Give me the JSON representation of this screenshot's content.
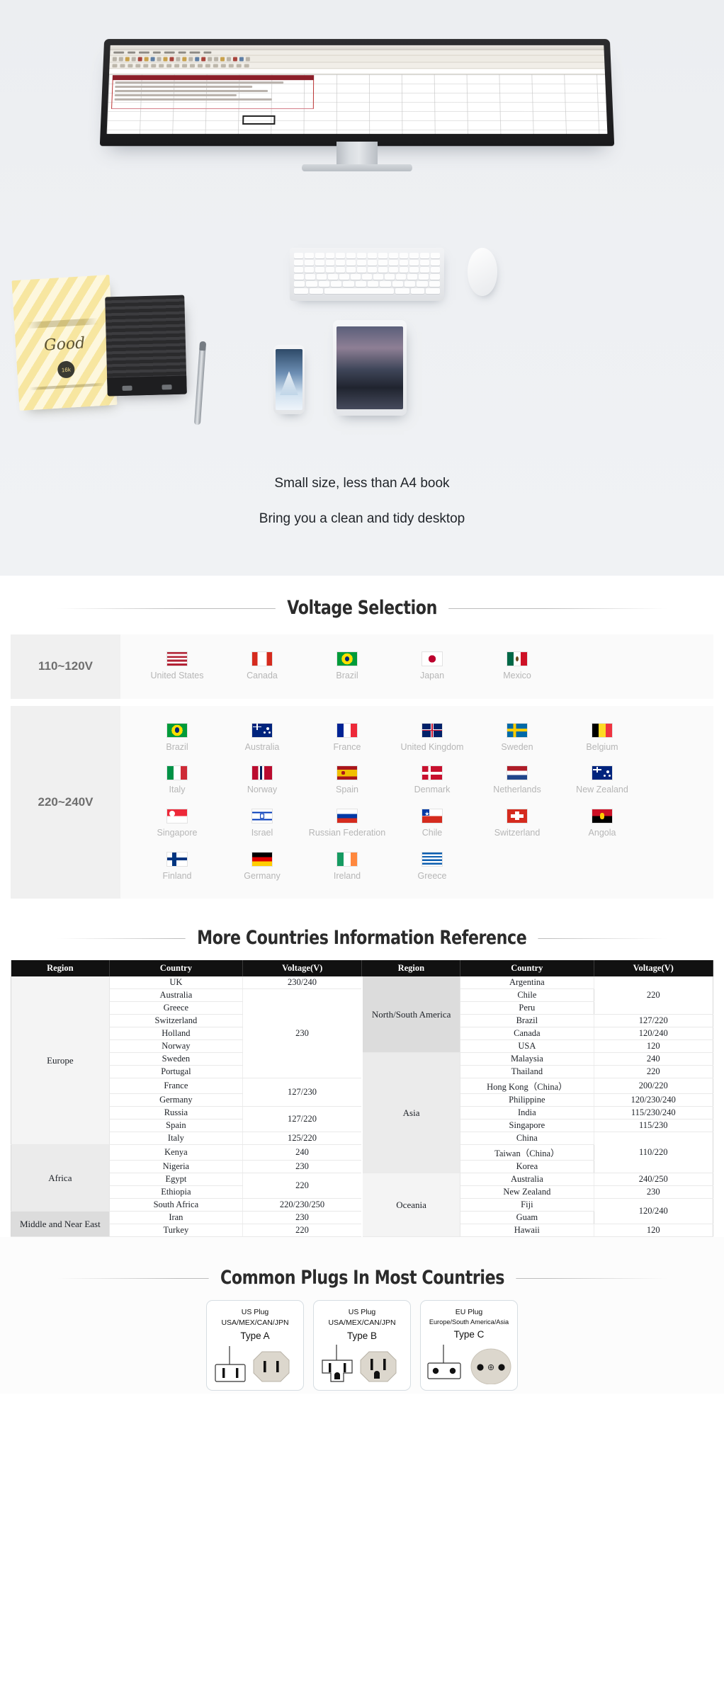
{
  "hero": {
    "caption_1": "Small size, less than A4 book",
    "caption_2": "Bring you a clean and tidy desktop",
    "notebook_label": "Good",
    "notebook_badge": "16k"
  },
  "voltage_section": {
    "title": "Voltage Selection",
    "groups": [
      {
        "label": "110~120V",
        "countries": [
          {
            "name": "United States",
            "flag": "us"
          },
          {
            "name": "Canada",
            "flag": "ca"
          },
          {
            "name": "Brazil",
            "flag": "br"
          },
          {
            "name": "Japan",
            "flag": "jp"
          },
          {
            "name": "Mexico",
            "flag": "mx"
          }
        ]
      },
      {
        "label": "220~240V",
        "countries": [
          {
            "name": "Brazil",
            "flag": "br"
          },
          {
            "name": "Australia",
            "flag": "au"
          },
          {
            "name": "France",
            "flag": "fr"
          },
          {
            "name": "United Kingdom",
            "flag": "gb"
          },
          {
            "name": "Sweden",
            "flag": "se"
          },
          {
            "name": "Belgium",
            "flag": "be"
          },
          {
            "name": "Italy",
            "flag": "it"
          },
          {
            "name": "Norway",
            "flag": "no"
          },
          {
            "name": "Spain",
            "flag": "es"
          },
          {
            "name": "Denmark",
            "flag": "dk"
          },
          {
            "name": "Netherlands",
            "flag": "nl"
          },
          {
            "name": "New Zealand",
            "flag": "nz"
          },
          {
            "name": "Singapore",
            "flag": "sg"
          },
          {
            "name": "Israel",
            "flag": "il"
          },
          {
            "name": "Russian Federation",
            "flag": "ru"
          },
          {
            "name": "Chile",
            "flag": "cl"
          },
          {
            "name": "Switzerland",
            "flag": "ch"
          },
          {
            "name": "Angola",
            "flag": "ao"
          },
          {
            "name": "Finland",
            "flag": "fi"
          },
          {
            "name": "Germany",
            "flag": "de"
          },
          {
            "name": "Ireland",
            "flag": "ie"
          },
          {
            "name": "Greece",
            "flag": "gr"
          }
        ]
      }
    ]
  },
  "reference_section": {
    "title": "More Countries Information Reference",
    "headers": [
      "Region",
      "Country",
      "Voltage(V)",
      "Region",
      "Country",
      "Voltage(V)"
    ],
    "left_rows": [
      {
        "region": "Europe",
        "region_span": 13,
        "region_shade": "light",
        "country": "UK",
        "voltage": "230/240",
        "voltage_span": 1
      },
      {
        "country": "Australia",
        "voltage": "230",
        "voltage_span": 7
      },
      {
        "country": "Greece"
      },
      {
        "country": "Switzerland"
      },
      {
        "country": "Holland"
      },
      {
        "country": "Norway"
      },
      {
        "country": "Sweden"
      },
      {
        "country": "Portugal"
      },
      {
        "country": "France",
        "voltage": "127/230",
        "voltage_span": 2
      },
      {
        "country": "Germany"
      },
      {
        "country": "Russia",
        "voltage": "127/220",
        "voltage_span": 2
      },
      {
        "country": "Spain"
      },
      {
        "country": "Italy",
        "voltage": "125/220",
        "voltage_span": 1
      },
      {
        "region": "Africa",
        "region_span": 5,
        "region_shade": "md",
        "country": "Kenya",
        "voltage": "240",
        "voltage_span": 1
      },
      {
        "country": "Nigeria",
        "voltage": "230",
        "voltage_span": 1
      },
      {
        "country": "Egypt",
        "voltage": "220",
        "voltage_span": 2
      },
      {
        "country": "Ethiopia"
      },
      {
        "country": "South Africa",
        "voltage": "220/230/250",
        "voltage_span": 1
      },
      {
        "region": "Middle and Near East",
        "region_span": 2,
        "region_shade": "dk",
        "country": "Iran",
        "voltage": "230",
        "voltage_span": 1
      },
      {
        "country": "Turkey",
        "voltage": "220",
        "voltage_span": 1
      }
    ],
    "right_rows": [
      {
        "region": "North/South America",
        "region_span": 6,
        "region_shade": "dk",
        "country": "Argentina",
        "voltage": "220",
        "voltage_span": 3
      },
      {
        "country": "Chile"
      },
      {
        "country": "Peru"
      },
      {
        "country": "Brazil",
        "voltage": "127/220",
        "voltage_span": 1
      },
      {
        "country": "Canada",
        "voltage": "120/240",
        "voltage_span": 1
      },
      {
        "country": "USA",
        "voltage": "120",
        "voltage_span": 1
      },
      {
        "region": "Asia",
        "region_span": 9,
        "region_shade": "md",
        "country": "Malaysia",
        "voltage": "240",
        "voltage_span": 1
      },
      {
        "country": "Thailand",
        "voltage": "220",
        "voltage_span": 1
      },
      {
        "country": "Hong Kong（China）",
        "voltage": "200/220",
        "voltage_span": 1
      },
      {
        "country": "Philippine",
        "voltage": "120/230/240",
        "voltage_span": 1
      },
      {
        "country": "India",
        "voltage": "115/230/240",
        "voltage_span": 1
      },
      {
        "country": "Singapore",
        "voltage": "115/230",
        "voltage_span": 1
      },
      {
        "country": "China",
        "voltage": "110/220",
        "voltage_span": 3
      },
      {
        "country": "Taiwan（China）"
      },
      {
        "country": "Korea"
      },
      {
        "region": "Oceania",
        "region_span": 5,
        "region_shade": "light",
        "country": "Australia",
        "voltage": "240/250",
        "voltage_span": 1
      },
      {
        "country": "New Zealand",
        "voltage": "230",
        "voltage_span": 1
      },
      {
        "country": "Fiji",
        "voltage": "120/240",
        "voltage_span": 2
      },
      {
        "country": "Guam"
      },
      {
        "country": "Hawaii",
        "voltage": "120",
        "voltage_span": 1
      }
    ]
  },
  "plugs_section": {
    "title": "Common Plugs In Most Countries",
    "cards": [
      {
        "line1": "US Plug",
        "line2": "USA/MEX/CAN/JPN",
        "line3": "Type A",
        "art": "type-a"
      },
      {
        "line1": "US Plug",
        "line2": "USA/MEX/CAN/JPN",
        "line3": "Type B",
        "art": "type-b"
      },
      {
        "line1": "EU Plug",
        "line2": "Europe/South America/Asia",
        "line3": "Type C",
        "art": "type-c"
      }
    ]
  },
  "colors": {
    "hero_bg": "#eef0f3",
    "heading": "#2b2b2b",
    "table_header_bg": "#111111",
    "label_gray": "#6f6f6f",
    "flag_caption": "#b6b6b6"
  }
}
